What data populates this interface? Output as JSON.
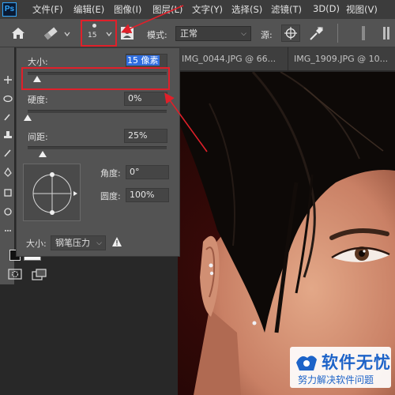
{
  "app": {
    "logo_text": "Ps"
  },
  "menubar": {
    "items": [
      {
        "label": "文件(F)"
      },
      {
        "label": "编辑(E)"
      },
      {
        "label": "图像(I)"
      },
      {
        "label": "图层(L)"
      },
      {
        "label": "文字(Y)"
      },
      {
        "label": "选择(S)"
      },
      {
        "label": "滤镜(T)"
      },
      {
        "label": "3D(D)"
      },
      {
        "label": "视图(V)"
      }
    ]
  },
  "options_bar": {
    "brush_size": "15",
    "mode_label": "模式:",
    "mode_value": "正常",
    "source_label": "源:"
  },
  "doc_tabs": [
    {
      "label": "IMG_0044.JPG @ 66..."
    },
    {
      "label": "IMG_1909.JPG @ 10..."
    }
  ],
  "brush_panel": {
    "size_label": "大小:",
    "size_value": "15 像素",
    "size_level": 0.07,
    "hardness_label": "硬度:",
    "hardness_value": "0%",
    "hardness_level": 0.0,
    "spacing_label": "间距:",
    "spacing_value": "25%",
    "spacing_level": 0.11,
    "angle_label": "角度:",
    "angle_value": "0°",
    "roundness_label": "圆度:",
    "roundness_value": "100%",
    "pressure_label": "大小:",
    "pressure_value": "钢笔压力"
  },
  "watermark": {
    "main": "软件无忧",
    "sub": "努力解决软件问题"
  },
  "colors": {
    "accent_red": "#e0202a",
    "selection_blue": "#2f6ee0",
    "watermark_blue": "#1d63c8"
  }
}
